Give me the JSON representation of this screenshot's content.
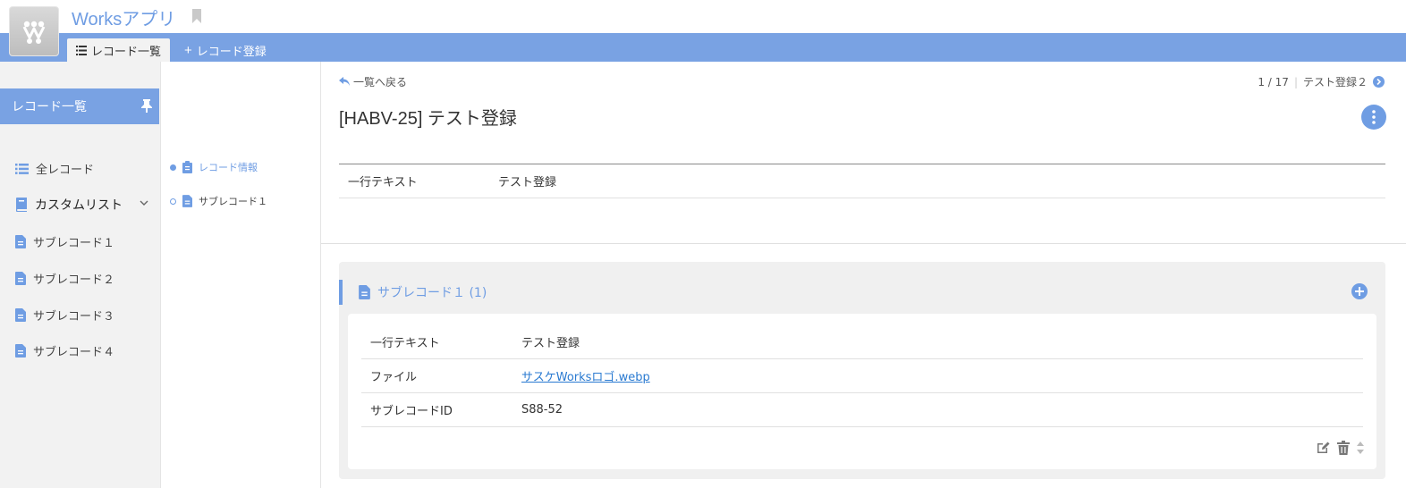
{
  "app": {
    "title": "Worksアプリ"
  },
  "tabs": {
    "list_label": "レコード一覧",
    "add_label": "レコード登録"
  },
  "sidebar": {
    "header": "レコード一覧",
    "items": [
      {
        "label": "全レコード",
        "icon": "list-icon"
      },
      {
        "label": "カスタムリスト",
        "icon": "book-icon"
      },
      {
        "label": "サブレコード１",
        "icon": "document-icon"
      },
      {
        "label": "サブレコード２",
        "icon": "document-icon"
      },
      {
        "label": "サブレコード３",
        "icon": "document-icon"
      },
      {
        "label": "サブレコード４",
        "icon": "document-icon"
      }
    ]
  },
  "toc": {
    "items": [
      {
        "label": "レコード情報",
        "active": true
      },
      {
        "label": "サブレコード１",
        "active": false
      }
    ]
  },
  "record": {
    "back_label": "一覧へ戻る",
    "pager": {
      "position": "1 / 17",
      "next_label": "テスト登録２"
    },
    "title": "[HABV-25] テスト登録",
    "fields": [
      {
        "label": "一行テキスト",
        "value": "テスト登録"
      }
    ]
  },
  "subrecord": {
    "title": "サブレコード１ (1)",
    "rows": [
      {
        "label": "一行テキスト",
        "value": "テスト登録"
      },
      {
        "label": "ファイル",
        "value": "サスケWorksロゴ.webp"
      },
      {
        "label": "サブレコードID",
        "value": "S88-52"
      }
    ]
  },
  "colors": {
    "accent": "#79a2e3",
    "link": "#2a7ad1"
  }
}
